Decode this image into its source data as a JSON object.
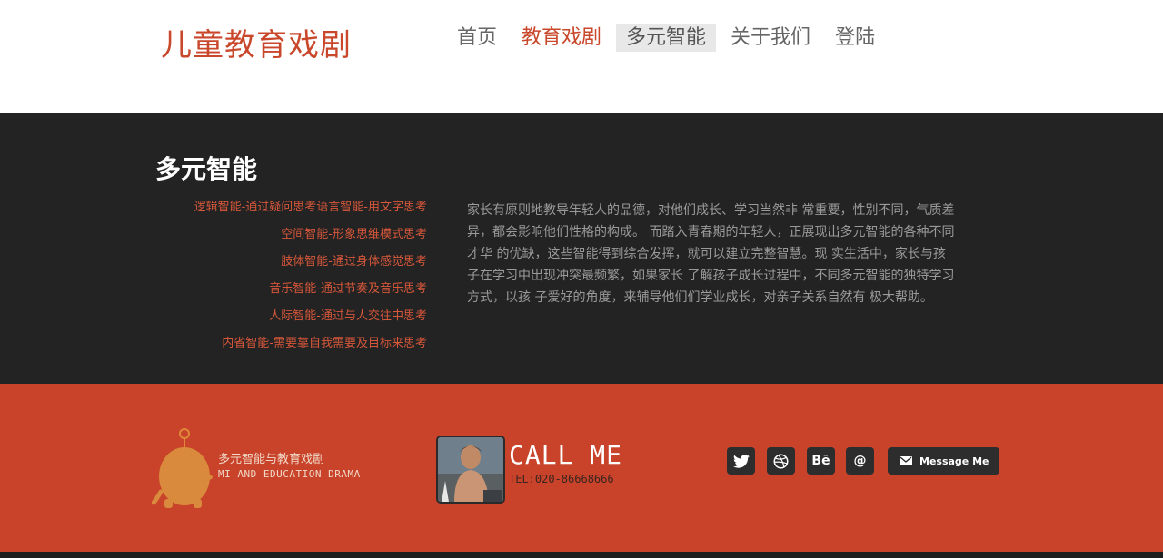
{
  "header": {
    "logo": "儿童教育戏剧",
    "nav": [
      "首页",
      "教育戏剧",
      "多元智能",
      "关于我们",
      "登陆"
    ]
  },
  "main": {
    "title": "多元智能",
    "intelligences": [
      "逻辑智能-通过疑问思考语言智能-用文字思考",
      "空间智能-形象思维模式思考",
      "肢体智能-通过身体感觉思考",
      "音乐智能-通过节奏及音乐思考",
      "人际智能-通过与人交往中思考",
      "内省智能-需要靠自我需要及目标来思考"
    ],
    "paragraph": "家长有原则地教导年轻人的品德，对他们成长、学习当然非 常重要，性别不同，气质差异，都会影响他们性格的构成。 而踏入青春期的年轻人，正展现出多元智能的各种不同才华 的优缺，这些智能得到综合发挥，就可以建立完整智慧。现 实生活中，家长与孩子在学习中出现冲突最频繁，如果家长 了解孩子成长过程中，不同多元智能的独特学习方式，以孩 子爱好的角度，来辅导他们们学业成长，对亲子关系自然有 极大帮助。"
  },
  "footer": {
    "brand_cn": "多元智能与教育戏剧",
    "brand_en": "MI AND EDUCATION DRAMA",
    "call_label": "CALL ME",
    "tel": "TEL:020-86668666",
    "social": [
      {
        "icon": "twitter-icon"
      },
      {
        "icon": "dribbble-icon"
      },
      {
        "icon": "behance-icon",
        "label": "Bē"
      },
      {
        "icon": "at-icon",
        "label": "@"
      }
    ],
    "message_button": "Message Me"
  },
  "colors": {
    "accent": "#c9472b",
    "dark": "#232323",
    "footer": "#c9432a",
    "button": "#2d2d2d"
  }
}
